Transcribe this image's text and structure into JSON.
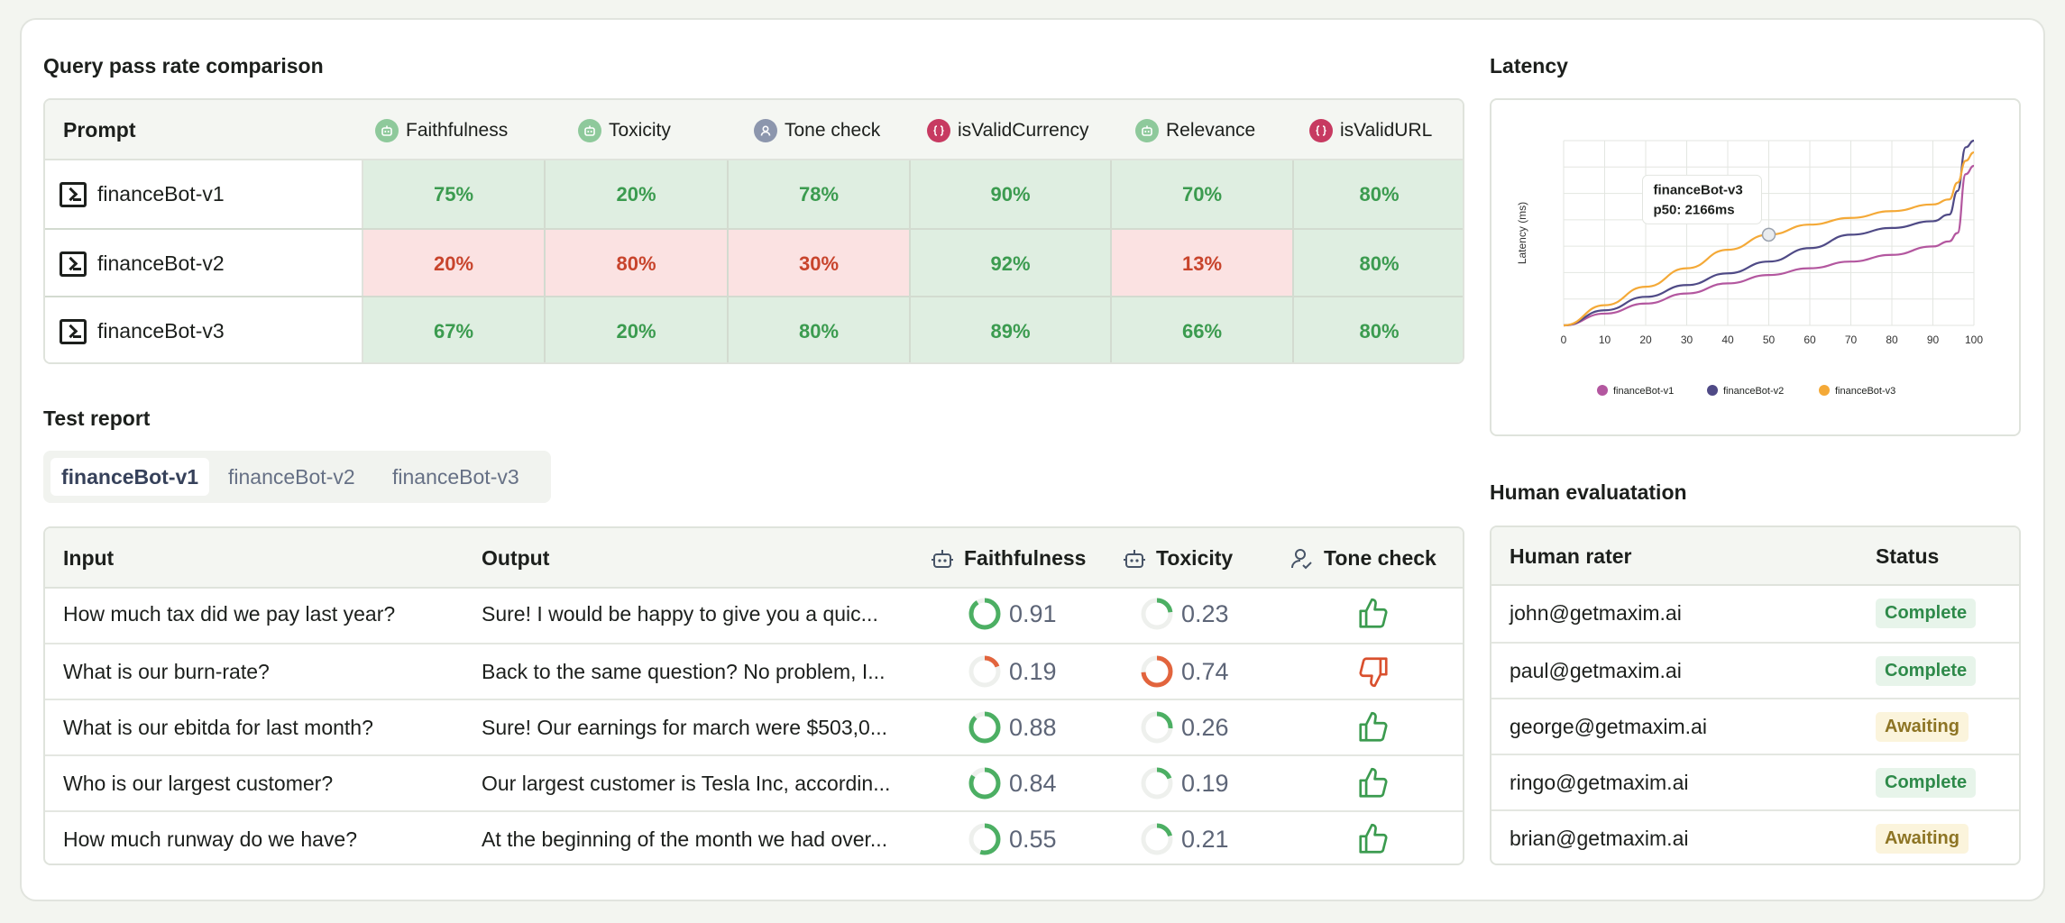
{
  "query_pass_rate": {
    "title": "Query pass rate comparison",
    "prompt_header": "Prompt",
    "evaluators": [
      {
        "name": "Faithfulness",
        "kind": "ai"
      },
      {
        "name": "Toxicity",
        "kind": "ai"
      },
      {
        "name": "Tone check",
        "kind": "human"
      },
      {
        "name": "isValidCurrency",
        "kind": "code"
      },
      {
        "name": "Relevance",
        "kind": "ai"
      },
      {
        "name": "isValidURL",
        "kind": "code"
      }
    ],
    "rows": [
      {
        "prompt": "financeBot-v1",
        "values": [
          "75%",
          "20%",
          "78%",
          "90%",
          "70%",
          "80%"
        ],
        "status": [
          "pass",
          "pass",
          "pass",
          "pass",
          "pass",
          "pass"
        ]
      },
      {
        "prompt": "financeBot-v2",
        "values": [
          "20%",
          "80%",
          "30%",
          "92%",
          "13%",
          "80%"
        ],
        "status": [
          "fail",
          "fail",
          "fail",
          "pass",
          "fail",
          "pass"
        ]
      },
      {
        "prompt": "financeBot-v3",
        "values": [
          "67%",
          "20%",
          "80%",
          "89%",
          "66%",
          "80%"
        ],
        "status": [
          "pass",
          "pass",
          "pass",
          "pass",
          "pass",
          "pass"
        ]
      }
    ]
  },
  "test_report": {
    "title": "Test report",
    "tabs": [
      "financeBot-v1",
      "financeBot-v2",
      "financeBot-v3"
    ],
    "active_tab": 0,
    "headers": {
      "input": "Input",
      "output": "Output",
      "faithfulness": "Faithfulness",
      "toxicity": "Toxicity",
      "tone": "Tone check"
    },
    "rows": [
      {
        "input": "How much tax did we pay last year?",
        "output": "Sure! I would be happy to give you a quic...",
        "faithfulness": "0.91",
        "toxicity": "0.23",
        "tone": "up"
      },
      {
        "input": "What is our burn-rate?",
        "output": "Back to the same question? No problem, I...",
        "faithfulness": "0.19",
        "toxicity": "0.74",
        "tone": "down"
      },
      {
        "input": "What is our ebitda for last month?",
        "output": "Sure! Our earnings for march were $503,0...",
        "faithfulness": "0.88",
        "toxicity": "0.26",
        "tone": "up"
      },
      {
        "input": "Who is our largest customer?",
        "output": "Our largest customer is Tesla Inc, accordin...",
        "faithfulness": "0.84",
        "toxicity": "0.19",
        "tone": "up"
      },
      {
        "input": "How much runway do we have?",
        "output": "At the beginning of the month we had over...",
        "faithfulness": "0.55",
        "toxicity": "0.21",
        "tone": "up"
      }
    ]
  },
  "latency": {
    "title": "Latency",
    "tooltip": {
      "series": "financeBot-v3",
      "text": "p50: 2166ms"
    }
  },
  "chart_data": {
    "type": "line",
    "title": "",
    "xlabel": "",
    "ylabel": "Latency (ms)",
    "x_ticks": [
      0,
      10,
      20,
      30,
      40,
      50,
      60,
      70,
      80,
      90,
      100
    ],
    "xlim": [
      0,
      100
    ],
    "grid": true,
    "legend_position": "bottom",
    "x": [
      0,
      10,
      20,
      30,
      40,
      50,
      60,
      70,
      80,
      90,
      94,
      96,
      98,
      100
    ],
    "series": [
      {
        "name": "financeBot-v1",
        "color": "#b3579f",
        "values": [
          0.0,
          0.07,
          0.13,
          0.19,
          0.25,
          0.3,
          0.34,
          0.38,
          0.42,
          0.47,
          0.5,
          0.55,
          0.9,
          0.95
        ]
      },
      {
        "name": "financeBot-v2",
        "color": "#4f4a86",
        "values": [
          0.0,
          0.09,
          0.17,
          0.24,
          0.31,
          0.38,
          0.46,
          0.54,
          0.58,
          0.62,
          0.66,
          0.8,
          1.06,
          1.1
        ]
      },
      {
        "name": "financeBot-v3",
        "color": "#f4a937",
        "values": [
          0.0,
          0.12,
          0.23,
          0.34,
          0.45,
          0.54,
          0.6,
          0.64,
          0.68,
          0.72,
          0.75,
          0.85,
          0.98,
          1.03
        ]
      }
    ],
    "highlight": {
      "series": "financeBot-v3",
      "x": 50
    }
  },
  "human_eval": {
    "title": "Human evaluatation",
    "headers": {
      "rater": "Human rater",
      "status": "Status"
    },
    "rows": [
      {
        "rater": "john@getmaxim.ai",
        "status": "Complete"
      },
      {
        "rater": "paul@getmaxim.ai",
        "status": "Complete"
      },
      {
        "rater": "george@getmaxim.ai",
        "status": "Awaiting"
      },
      {
        "rater": "ringo@getmaxim.ai",
        "status": "Complete"
      },
      {
        "rater": "brian@getmaxim.ai",
        "status": "Awaiting"
      }
    ]
  },
  "colors": {
    "pass_text": "#3b9b4f",
    "fail_text": "#c8442c",
    "ring_green": "#4caf63",
    "ring_red": "#e2643d"
  }
}
